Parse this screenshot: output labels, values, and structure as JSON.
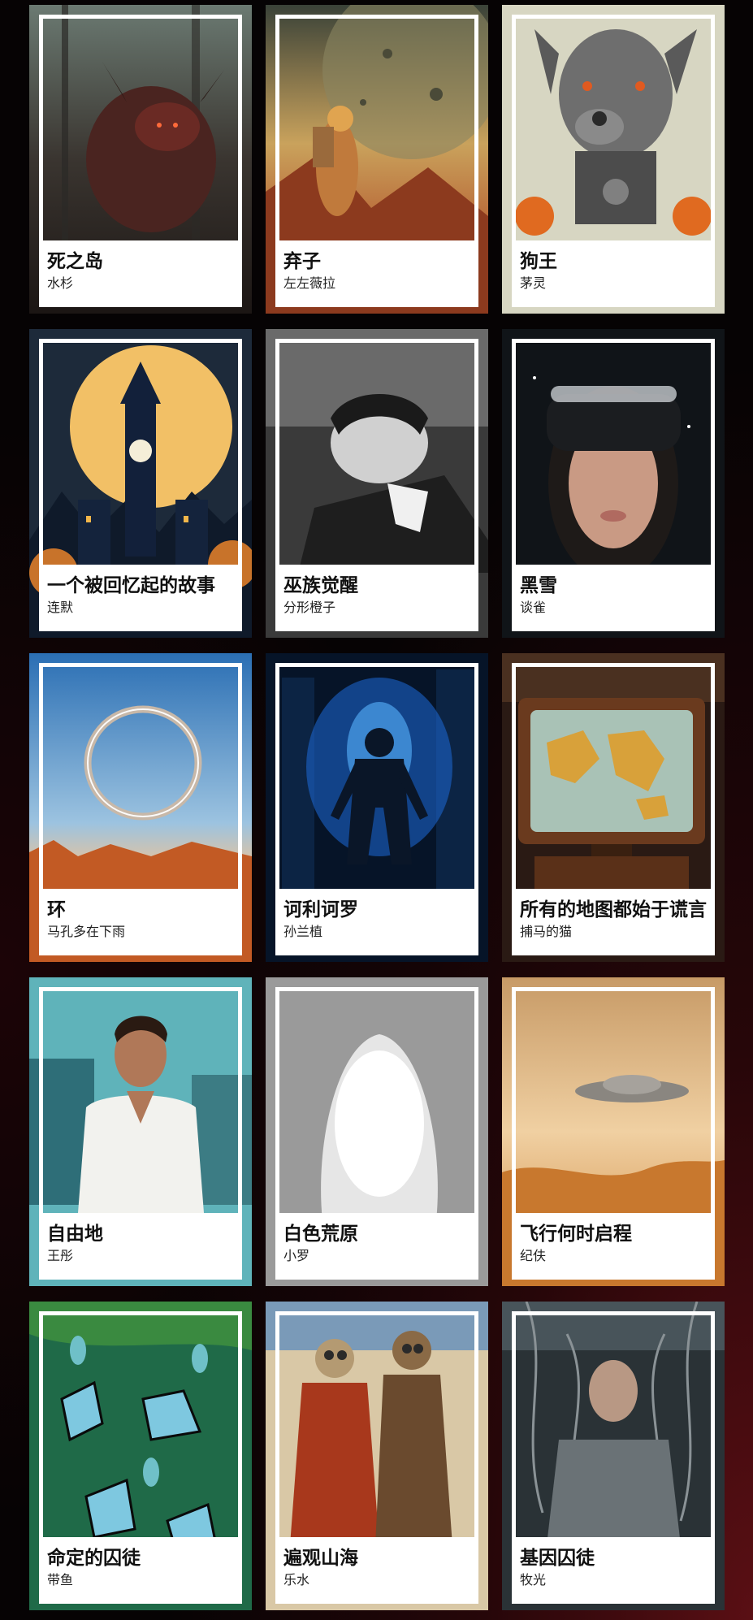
{
  "books": [
    {
      "title": "死之岛",
      "author": "水杉",
      "art": "demon-in-forest"
    },
    {
      "title": "弃子",
      "author": "左左薇拉",
      "art": "astronaut-on-planet"
    },
    {
      "title": "狗王",
      "author": "茅灵",
      "art": "cyborg-dog"
    },
    {
      "title": "一个被回忆起的故事",
      "author": "连默",
      "art": "clock-tower-moon"
    },
    {
      "title": "巫族觉醒",
      "author": "分形橙子",
      "art": "sleeping-figure"
    },
    {
      "title": "黑雪",
      "author": "谈雀",
      "art": "vr-headset-woman"
    },
    {
      "title": "环",
      "author": "马孔多在下雨",
      "art": "ring-over-desert"
    },
    {
      "title": "诃利诃罗",
      "author": "孙兰植",
      "art": "glowing-figure-city"
    },
    {
      "title": "所有的地图都始于谎言",
      "author": "捕马的猫",
      "art": "old-tv-world-map"
    },
    {
      "title": "自由地",
      "author": "王彤",
      "art": "smiling-nurse"
    },
    {
      "title": "白色荒原",
      "author": "小罗",
      "art": "white-ice-cave"
    },
    {
      "title": "飞行何时启程",
      "author": "纪伕",
      "art": "ufo-over-dunes"
    },
    {
      "title": "命定的囚徒",
      "author": "带鱼",
      "art": "butterflies-cocoons"
    },
    {
      "title": "遍观山海",
      "author": "乐水",
      "art": "two-robots"
    },
    {
      "title": "基因囚徒",
      "author": "牧光",
      "art": "man-in-machine"
    }
  ]
}
